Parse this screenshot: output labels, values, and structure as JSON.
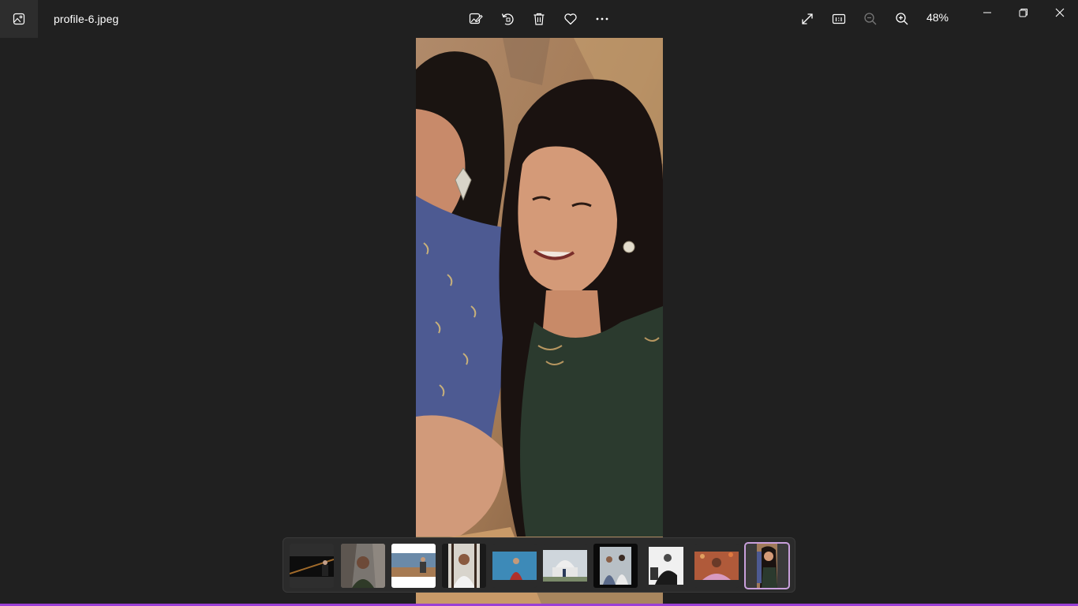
{
  "titlebar": {
    "file_name": "profile-6.jpeg",
    "zoom_level": "48%",
    "app_icon": "photos-app-icon",
    "toolbar_icons": [
      "edit-image-icon",
      "rotate-icon",
      "delete-icon",
      "favorite-heart-icon",
      "more-options-icon"
    ],
    "view_icons": [
      "fullscreen-icon",
      "actual-size-icon",
      "zoom-out-icon",
      "zoom-in-icon"
    ],
    "window_icons": [
      "minimize-icon",
      "restore-icon",
      "close-icon"
    ]
  },
  "photo": {
    "description_icon": "portrait-photo"
  },
  "filmstrip": {
    "thumbnail_count": 10,
    "selected_index": 9
  },
  "colors": {
    "background": "#202020",
    "selected_outline": "#c9a0dc",
    "taskbar_accent": "#9b3fd6"
  }
}
